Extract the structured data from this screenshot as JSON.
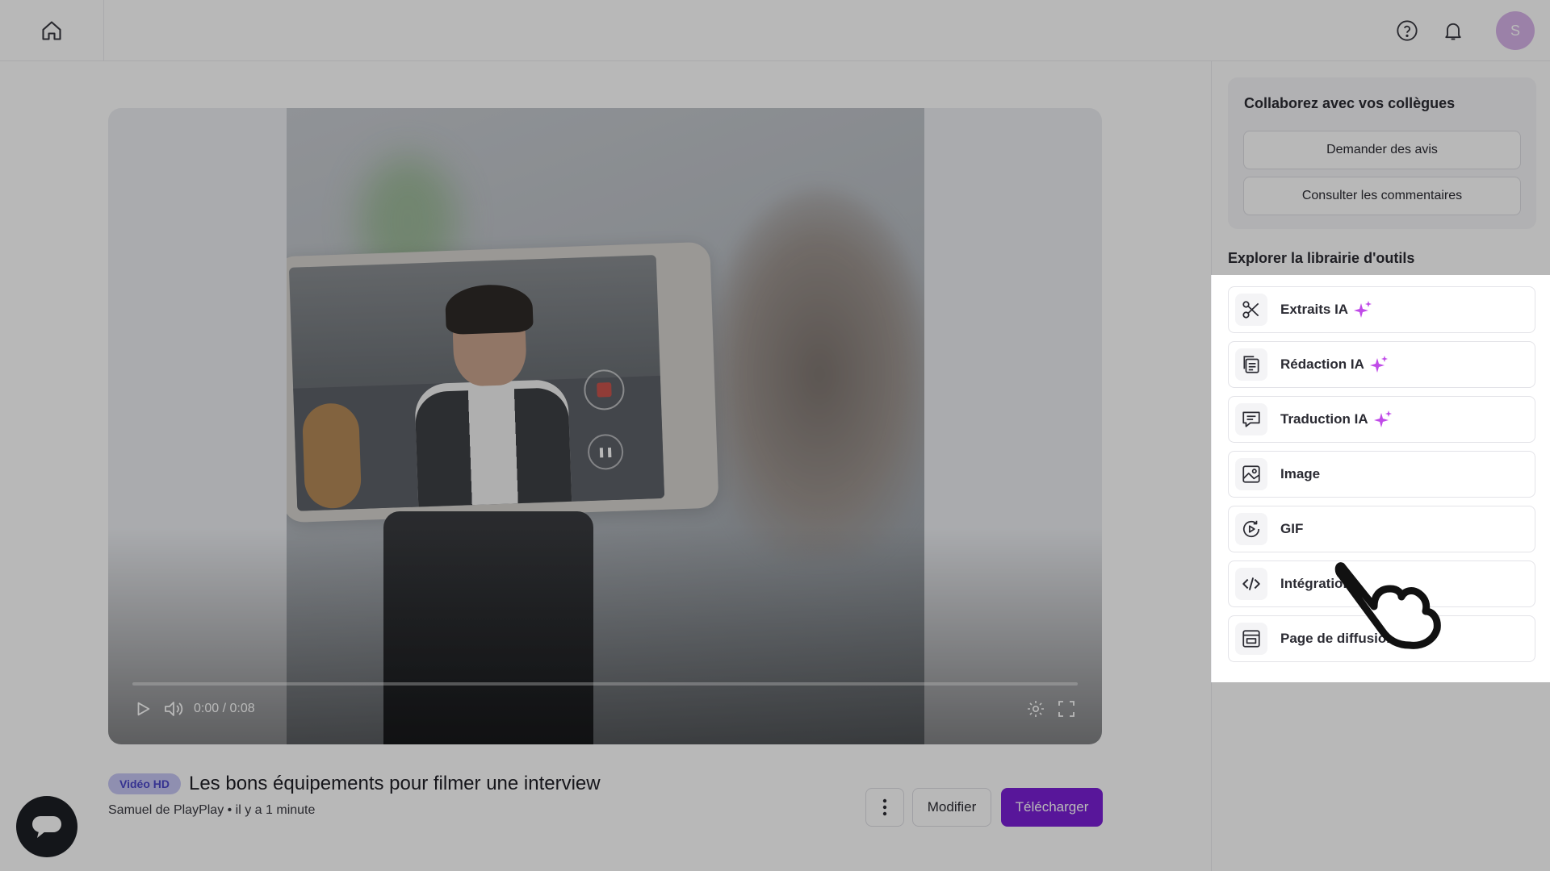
{
  "header": {
    "home_icon": "home-icon",
    "help_icon": "help-icon",
    "bell_icon": "bell-icon",
    "avatar_initial": "S",
    "avatar_color": "#d7b3e9"
  },
  "player": {
    "time": "0:00 / 0:08",
    "progress": 0,
    "icons": [
      "play-icon",
      "volume-icon",
      "settings-icon",
      "fullscreen-icon"
    ]
  },
  "video": {
    "badge": "Vidéo HD",
    "title": "Les bons équipements pour filmer une interview",
    "meta": "Samuel de PlayPlay • il y a 1 minute"
  },
  "actions": {
    "edit_label": "Modifier",
    "download_label": "Télécharger",
    "accent": "#7b1fd6"
  },
  "collab": {
    "title": "Collaborez avec vos collègues",
    "request_label": "Demander des avis",
    "comments_label": "Consulter les commentaires"
  },
  "tools": {
    "title": "Explorer la librairie d'outils",
    "items": [
      {
        "label": "Extraits IA",
        "icon": "scissors-icon",
        "ai": true
      },
      {
        "label": "Rédaction IA",
        "icon": "document-icon",
        "ai": true
      },
      {
        "label": "Traduction IA",
        "icon": "chat-icon",
        "ai": true
      },
      {
        "label": "Image",
        "icon": "image-icon",
        "ai": false
      },
      {
        "label": "GIF",
        "icon": "gif-play-icon",
        "ai": false
      },
      {
        "label": "Intégration",
        "icon": "code-icon",
        "ai": false
      },
      {
        "label": "Page de diffusion",
        "icon": "browser-page-icon",
        "ai": false
      }
    ]
  }
}
